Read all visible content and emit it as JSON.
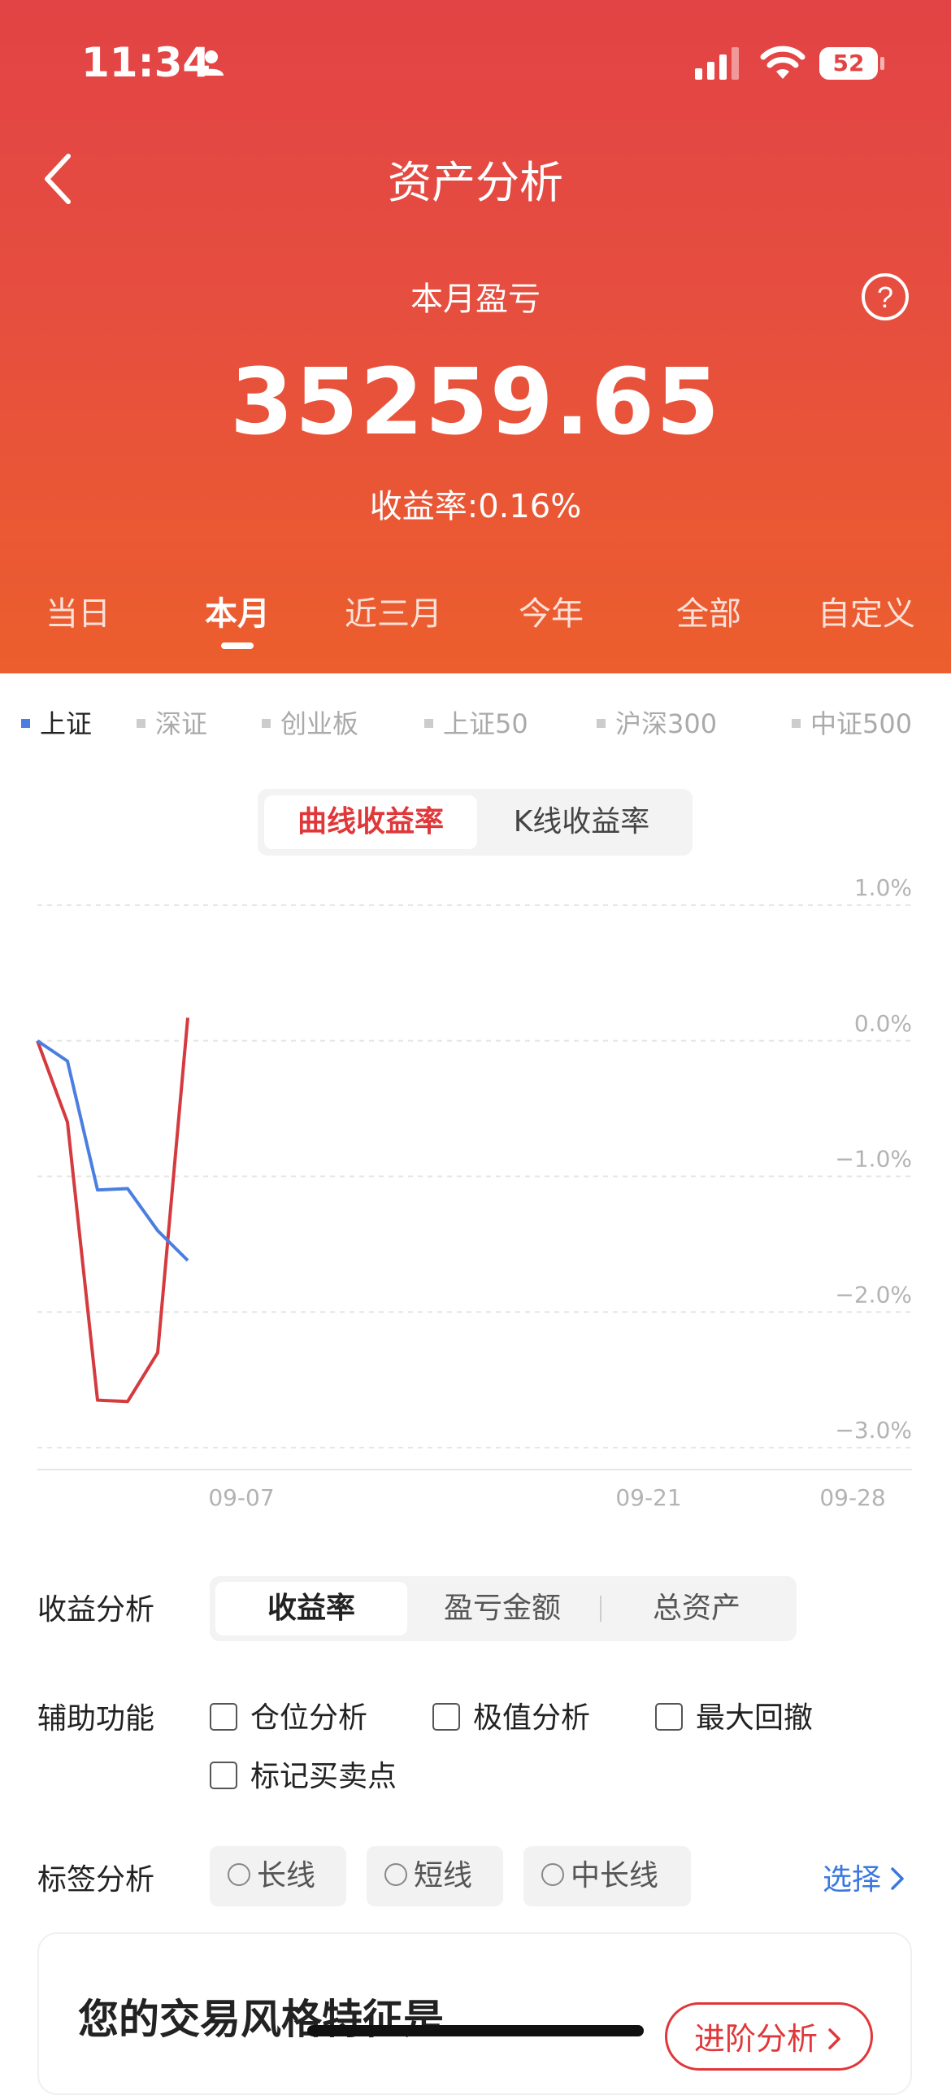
{
  "status_bar": {
    "time": "11:34",
    "battery": "52"
  },
  "header": {
    "title": "资产分析",
    "summary_label": "本月盈亏",
    "profit_value": "35259.65",
    "yield_rate": "收益率:0.16%"
  },
  "period_tabs": [
    "当日",
    "本月",
    "近三月",
    "今年",
    "全部",
    "自定义"
  ],
  "active_period": "本月",
  "index_tabs": [
    "上证",
    "深证",
    "创业板",
    "上证50",
    "沪深300",
    "中证500"
  ],
  "active_index": "上证",
  "chart_toggle": {
    "curve": "曲线收益率",
    "kline": "K线收益率"
  },
  "chart_data": {
    "type": "line",
    "y_ticks": [
      "1.0%",
      "0.0%",
      "−1.0%",
      "−2.0%",
      "−3.0%"
    ],
    "x_ticks": [
      "09-07",
      "09-21",
      "09-28"
    ],
    "ylim": [
      -3.0,
      1.0
    ],
    "grid": true,
    "series": [
      {
        "color": "#d43a3e",
        "values": [
          0.0,
          -0.6,
          -2.65,
          -2.66,
          -2.3,
          0.17
        ]
      },
      {
        "color": "#4a7ee0",
        "values": [
          0.0,
          -0.15,
          -1.1,
          -1.09,
          -1.4,
          -1.62
        ]
      }
    ]
  },
  "profit_analysis": {
    "label": "收益分析",
    "options": [
      "收益率",
      "盈亏金额",
      "总资产"
    ],
    "active": "收益率"
  },
  "aux": {
    "label": "辅助功能",
    "options": [
      "仓位分析",
      "极值分析",
      "最大回撤",
      "标记买卖点"
    ]
  },
  "tag_analysis": {
    "label": "标签分析",
    "options": [
      "长线",
      "短线",
      "中长线"
    ],
    "select": "选择"
  },
  "style_card": {
    "title": "您的交易风格特征是...",
    "button": "进阶分析"
  }
}
